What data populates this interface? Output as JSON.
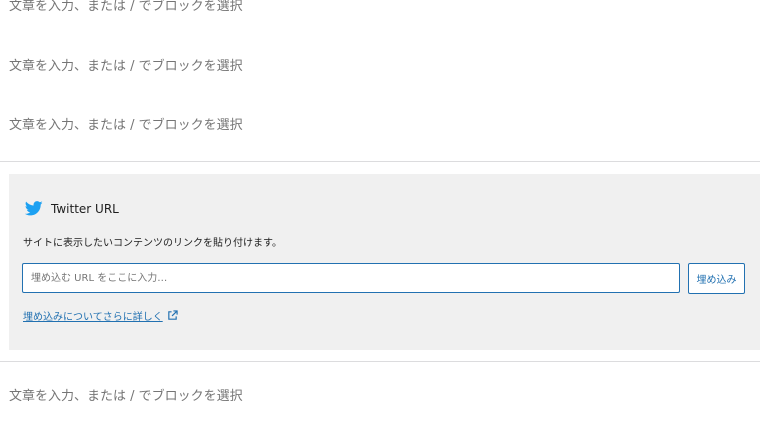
{
  "paragraphs": {
    "p1": "文章を入力、または / でブロックを選択",
    "p2": "文章を入力、または / でブロックを選択",
    "p3": "文章を入力、または / でブロックを選択",
    "p4": "文章を入力、または / でブロックを選択"
  },
  "embed": {
    "icon": "twitter-icon",
    "title": "Twitter URL",
    "description": "サイトに表示したいコンテンツのリンクを貼り付けます。",
    "input_placeholder": "埋め込む URL をここに入力…",
    "input_value": "",
    "button_label": "埋め込み",
    "learn_more_label": "埋め込みについてさらに詳しく",
    "learn_more_icon": "external-link-icon"
  },
  "colors": {
    "accent": "#2271b1",
    "twitter": "#1da1f2",
    "block_background": "#f0f0f0",
    "placeholder_text": "#757575"
  }
}
